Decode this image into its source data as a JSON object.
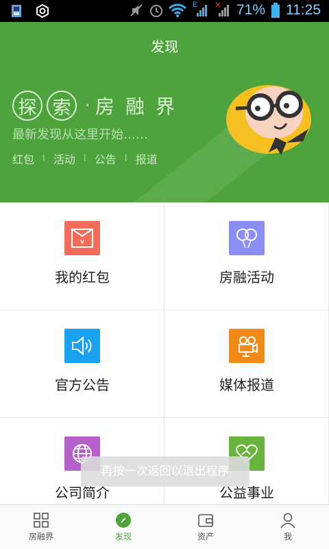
{
  "status_bar": {
    "battery": "71%",
    "time": "11:25",
    "network_label": "E",
    "icons": [
      "phone-storage-icon",
      "settings-icon",
      "mute-icon",
      "alarm-icon",
      "wifi-icon",
      "signal-icon",
      "signal-icon",
      "battery-icon"
    ]
  },
  "header": {
    "title": "发现",
    "slogan_chars": [
      "探",
      "索"
    ],
    "slogan_dot": "·",
    "slogan_brand": "房融界",
    "tagline": "最新发现从这里开始……",
    "links": [
      "红包",
      "活动",
      "公告",
      "报道"
    ],
    "link_separator": "I"
  },
  "grid": [
    {
      "label": "我的红包",
      "icon": "red-envelope-icon",
      "color": "#f26b5b"
    },
    {
      "label": "房融活动",
      "icon": "balloons-icon",
      "color": "#8b8ff5"
    },
    {
      "label": "官方公告",
      "icon": "speaker-icon",
      "color": "#1aa1f0"
    },
    {
      "label": "媒体报道",
      "icon": "camera-icon",
      "color": "#f28a1a"
    },
    {
      "label": "公司简介",
      "icon": "globe-icon",
      "color": "#b55fc9"
    },
    {
      "label": "公益事业",
      "icon": "heart-hands-icon",
      "color": "#69b33f"
    }
  ],
  "toast": "再按一次返回以退出程序",
  "bottom_nav": [
    {
      "label": "房融界",
      "icon": "grid-icon",
      "active": false
    },
    {
      "label": "发现",
      "icon": "compass-icon",
      "active": true
    },
    {
      "label": "资产",
      "icon": "wallet-icon",
      "active": false
    },
    {
      "label": "我",
      "icon": "person-icon",
      "active": false
    }
  ],
  "accent": "#4ea33d"
}
